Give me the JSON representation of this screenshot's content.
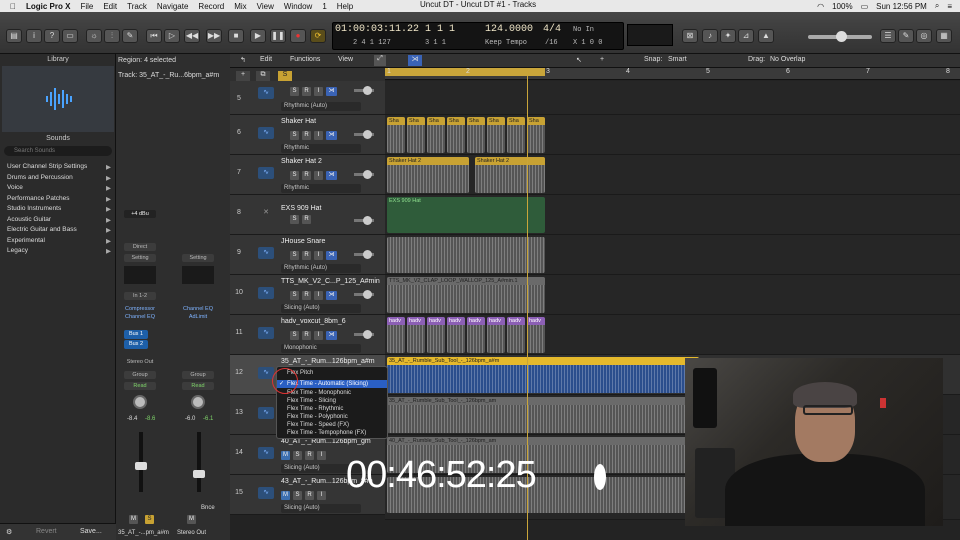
{
  "menubar": {
    "app": "Logic Pro X",
    "items": [
      "File",
      "Edit",
      "Track",
      "Navigate",
      "Record",
      "Mix",
      "View",
      "Window",
      "1",
      "Help"
    ],
    "window_title": "Uncut DT - Uncut DT #1 - Tracks",
    "battery": "100%",
    "clock": "Sun 12:56 PM"
  },
  "lcd": {
    "time_top": "01:00:03:11.22",
    "time_bottom": "2  4  1  127",
    "bars_top": "1  1  1",
    "bars_bottom": "3  1  1",
    "tempo": "124.0000",
    "tempo_mode": "Keep Tempo",
    "sig_top": "1",
    "sig_bottom": "1",
    "sig": "4/4",
    "div": "/16",
    "in": "No In",
    "out": "X  1  0  0"
  },
  "library": {
    "title": "Library",
    "sounds": "Sounds",
    "search_placeholder": "Search Sounds",
    "items": [
      "User Channel Strip Settings",
      "Drums and Percussion",
      "Voice",
      "Performance Patches",
      "Studio Instruments",
      "Acoustic Guitar",
      "Electric Guitar and Bass",
      "Experimental",
      "Legacy"
    ],
    "revert": "Revert",
    "save": "Save..."
  },
  "inspector": {
    "region": "Region: 4 selected",
    "track": "Track: 35_AT_-_Ru...6bpm_a#m",
    "gain": "+4 dBu",
    "direct": "Direct",
    "setting1": "Setting",
    "setting2": "Setting",
    "io": "In 1-2",
    "plugin1a": "Compressor",
    "plugin1b": "Channel EQ",
    "plugin2a": "Channel EQ",
    "plugin2b": "AdLimit",
    "bus1": "Bus 1",
    "bus2": "Bus 2",
    "out": "Stereo Out",
    "group": "Group",
    "read1": "Read",
    "read2": "Read",
    "vol1a": "-8.4",
    "vol1b": "-8.6",
    "vol2a": "-6.0",
    "vol2b": "-6.1",
    "bnce": "Bnce",
    "name1": "35_AT_-...pm_a#m",
    "name2": "Stereo Out",
    "m": "M",
    "s": "S"
  },
  "toolbar": {
    "edit": "Edit",
    "functions": "Functions",
    "view": "View",
    "snap_label": "Snap:",
    "snap": "Smart",
    "drag_label": "Drag:",
    "drag": "No Overlap"
  },
  "ruler": [
    "1",
    "2",
    "3",
    "4",
    "5",
    "6",
    "7",
    "8"
  ],
  "tracks": [
    {
      "num": "5",
      "name": "",
      "mode": "Rhythmic (Auto)"
    },
    {
      "num": "6",
      "name": "Shaker Hat",
      "mode": "Rhythmic"
    },
    {
      "num": "7",
      "name": "Shaker Hat 2",
      "mode": "Rhythmic"
    },
    {
      "num": "8",
      "name": "EXS 909 Hat",
      "mode": ""
    },
    {
      "num": "9",
      "name": "JHouse Snare",
      "mode": "Rhythmic (Auto)"
    },
    {
      "num": "10",
      "name": "TTS_MK_V2_C...P_125_A#min",
      "mode": "Slicing (Auto)"
    },
    {
      "num": "11",
      "name": "hadv_voxcut_8bm_6",
      "mode": "Monophonic"
    },
    {
      "num": "12",
      "name": "35_AT_-_Rum...126bpm_a#m",
      "mode": ""
    },
    {
      "num": "13",
      "name": "",
      "mode": ""
    },
    {
      "num": "14",
      "name": "40_AT_-_Rum...126bpm_gm",
      "mode": "Slicing (Auto)"
    },
    {
      "num": "15",
      "name": "43_AT_-_Rum...126bpm_f#m",
      "mode": "Slicing (Auto)"
    }
  ],
  "regions": {
    "sha": "Sha",
    "shaker2": "Shaker Hat 2",
    "exs": "EXS 909 Hat",
    "tts": "TTS_MK_V2_CLAP_LOOP_WALLOP_125_A#min.1",
    "hadv": "hadv",
    "r12": "35_AT_-_Rumble_Sub_Tool_-_126bpm_a#m",
    "r13": "35_AT_-_Rumble_Sub_Tool_-_126bpm_am",
    "r14": "40_AT_-_Rumble_Sub_Tool_-_126bpm_am"
  },
  "flex_menu": {
    "items": [
      "Flex Pitch",
      "Flex Time - Automatic (Slicing)",
      "Flex Time - Monophonic",
      "Flex Time - Slicing",
      "Flex Time - Rhythmic",
      "Flex Time - Polyphonic",
      "Flex Time - Speed (FX)",
      "Flex Time - Tempophone (FX)"
    ],
    "selected_index": 1
  },
  "timecode": "00:46:52:25"
}
